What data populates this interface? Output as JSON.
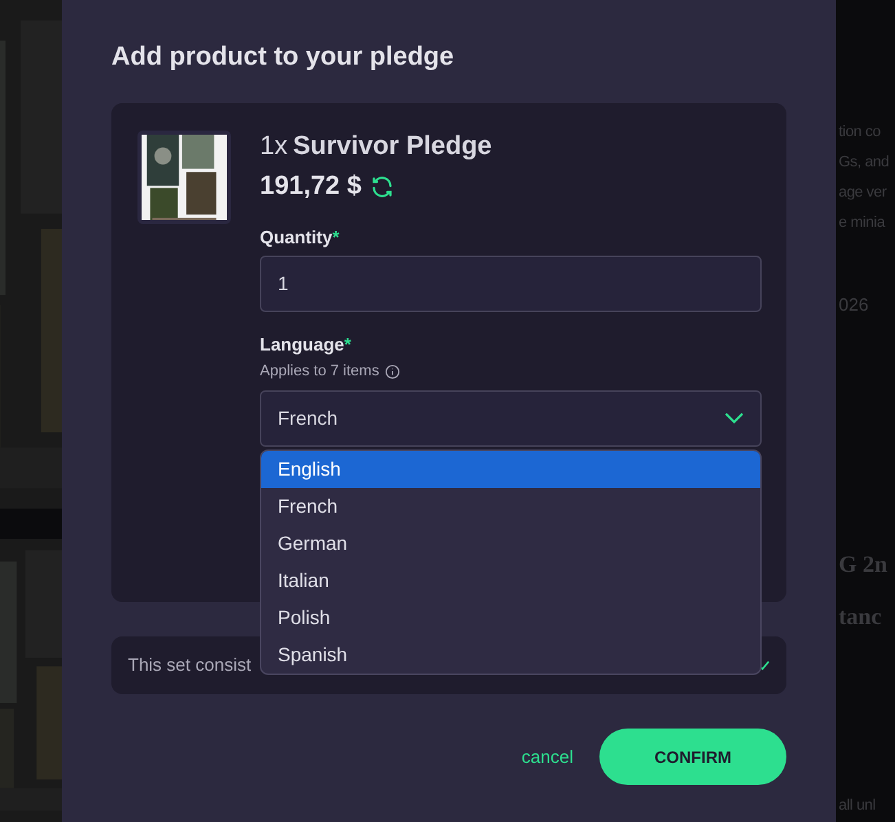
{
  "background": {
    "fragments": [
      {
        "text": "tion co"
      },
      {
        "text": "Gs, and"
      },
      {
        "text": "age ver"
      },
      {
        "text": "e minia"
      },
      {
        "text": "026"
      },
      {
        "text": "G 2n"
      },
      {
        "text": "tanc"
      },
      {
        "text": "all unl"
      }
    ]
  },
  "dialog": {
    "title": "Add product to your pledge",
    "product": {
      "quantity_prefix": "1x",
      "name": "Survivor Pledge",
      "price": "191,72 $"
    },
    "quantity": {
      "label": "Quantity",
      "required": "*",
      "value": "1"
    },
    "language": {
      "label": "Language",
      "required": "*",
      "hint": "Applies to 7 items",
      "value": "French",
      "expanded": true,
      "options": [
        {
          "label": "English",
          "highlighted": true
        },
        {
          "label": "French",
          "highlighted": false
        },
        {
          "label": "German",
          "highlighted": false
        },
        {
          "label": "Italian",
          "highlighted": false
        },
        {
          "label": "Polish",
          "highlighted": false
        },
        {
          "label": "Spanish",
          "highlighted": false
        }
      ]
    },
    "set_note": "This set consist",
    "buttons": [
      {
        "kind": "link",
        "label": "cancel"
      },
      {
        "kind": "primary",
        "label": "CONFIRM"
      }
    ]
  }
}
